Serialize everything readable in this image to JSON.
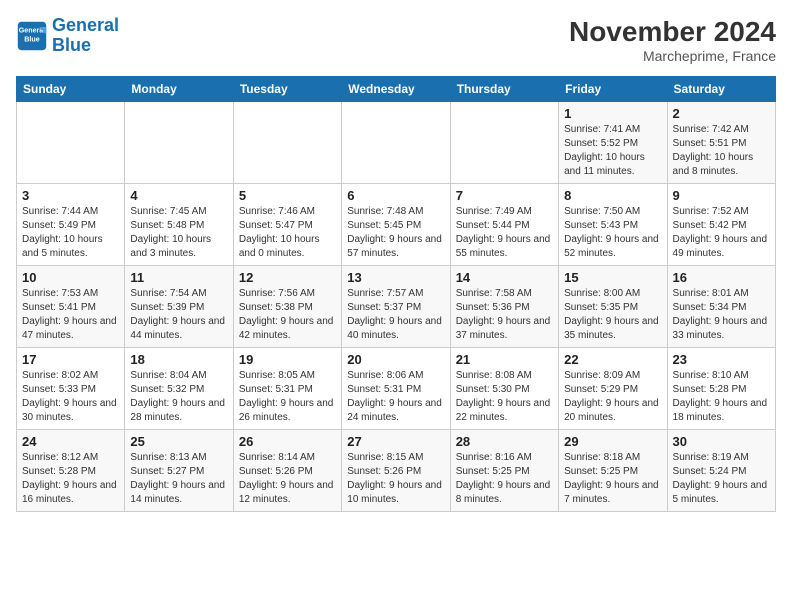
{
  "header": {
    "logo_line1": "General",
    "logo_line2": "Blue",
    "month": "November 2024",
    "location": "Marcheprime, France"
  },
  "weekdays": [
    "Sunday",
    "Monday",
    "Tuesday",
    "Wednesday",
    "Thursday",
    "Friday",
    "Saturday"
  ],
  "weeks": [
    [
      {
        "day": "",
        "info": ""
      },
      {
        "day": "",
        "info": ""
      },
      {
        "day": "",
        "info": ""
      },
      {
        "day": "",
        "info": ""
      },
      {
        "day": "",
        "info": ""
      },
      {
        "day": "1",
        "info": "Sunrise: 7:41 AM\nSunset: 5:52 PM\nDaylight: 10 hours and 11 minutes."
      },
      {
        "day": "2",
        "info": "Sunrise: 7:42 AM\nSunset: 5:51 PM\nDaylight: 10 hours and 8 minutes."
      }
    ],
    [
      {
        "day": "3",
        "info": "Sunrise: 7:44 AM\nSunset: 5:49 PM\nDaylight: 10 hours and 5 minutes."
      },
      {
        "day": "4",
        "info": "Sunrise: 7:45 AM\nSunset: 5:48 PM\nDaylight: 10 hours and 3 minutes."
      },
      {
        "day": "5",
        "info": "Sunrise: 7:46 AM\nSunset: 5:47 PM\nDaylight: 10 hours and 0 minutes."
      },
      {
        "day": "6",
        "info": "Sunrise: 7:48 AM\nSunset: 5:45 PM\nDaylight: 9 hours and 57 minutes."
      },
      {
        "day": "7",
        "info": "Sunrise: 7:49 AM\nSunset: 5:44 PM\nDaylight: 9 hours and 55 minutes."
      },
      {
        "day": "8",
        "info": "Sunrise: 7:50 AM\nSunset: 5:43 PM\nDaylight: 9 hours and 52 minutes."
      },
      {
        "day": "9",
        "info": "Sunrise: 7:52 AM\nSunset: 5:42 PM\nDaylight: 9 hours and 49 minutes."
      }
    ],
    [
      {
        "day": "10",
        "info": "Sunrise: 7:53 AM\nSunset: 5:41 PM\nDaylight: 9 hours and 47 minutes."
      },
      {
        "day": "11",
        "info": "Sunrise: 7:54 AM\nSunset: 5:39 PM\nDaylight: 9 hours and 44 minutes."
      },
      {
        "day": "12",
        "info": "Sunrise: 7:56 AM\nSunset: 5:38 PM\nDaylight: 9 hours and 42 minutes."
      },
      {
        "day": "13",
        "info": "Sunrise: 7:57 AM\nSunset: 5:37 PM\nDaylight: 9 hours and 40 minutes."
      },
      {
        "day": "14",
        "info": "Sunrise: 7:58 AM\nSunset: 5:36 PM\nDaylight: 9 hours and 37 minutes."
      },
      {
        "day": "15",
        "info": "Sunrise: 8:00 AM\nSunset: 5:35 PM\nDaylight: 9 hours and 35 minutes."
      },
      {
        "day": "16",
        "info": "Sunrise: 8:01 AM\nSunset: 5:34 PM\nDaylight: 9 hours and 33 minutes."
      }
    ],
    [
      {
        "day": "17",
        "info": "Sunrise: 8:02 AM\nSunset: 5:33 PM\nDaylight: 9 hours and 30 minutes."
      },
      {
        "day": "18",
        "info": "Sunrise: 8:04 AM\nSunset: 5:32 PM\nDaylight: 9 hours and 28 minutes."
      },
      {
        "day": "19",
        "info": "Sunrise: 8:05 AM\nSunset: 5:31 PM\nDaylight: 9 hours and 26 minutes."
      },
      {
        "day": "20",
        "info": "Sunrise: 8:06 AM\nSunset: 5:31 PM\nDaylight: 9 hours and 24 minutes."
      },
      {
        "day": "21",
        "info": "Sunrise: 8:08 AM\nSunset: 5:30 PM\nDaylight: 9 hours and 22 minutes."
      },
      {
        "day": "22",
        "info": "Sunrise: 8:09 AM\nSunset: 5:29 PM\nDaylight: 9 hours and 20 minutes."
      },
      {
        "day": "23",
        "info": "Sunrise: 8:10 AM\nSunset: 5:28 PM\nDaylight: 9 hours and 18 minutes."
      }
    ],
    [
      {
        "day": "24",
        "info": "Sunrise: 8:12 AM\nSunset: 5:28 PM\nDaylight: 9 hours and 16 minutes."
      },
      {
        "day": "25",
        "info": "Sunrise: 8:13 AM\nSunset: 5:27 PM\nDaylight: 9 hours and 14 minutes."
      },
      {
        "day": "26",
        "info": "Sunrise: 8:14 AM\nSunset: 5:26 PM\nDaylight: 9 hours and 12 minutes."
      },
      {
        "day": "27",
        "info": "Sunrise: 8:15 AM\nSunset: 5:26 PM\nDaylight: 9 hours and 10 minutes."
      },
      {
        "day": "28",
        "info": "Sunrise: 8:16 AM\nSunset: 5:25 PM\nDaylight: 9 hours and 8 minutes."
      },
      {
        "day": "29",
        "info": "Sunrise: 8:18 AM\nSunset: 5:25 PM\nDaylight: 9 hours and 7 minutes."
      },
      {
        "day": "30",
        "info": "Sunrise: 8:19 AM\nSunset: 5:24 PM\nDaylight: 9 hours and 5 minutes."
      }
    ]
  ]
}
